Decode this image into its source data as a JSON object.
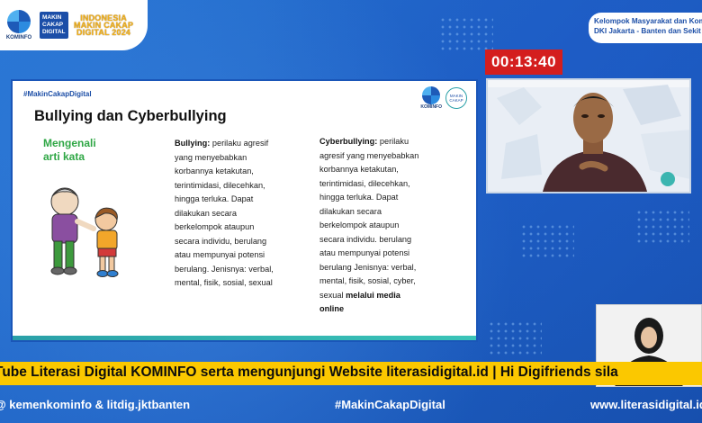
{
  "header": {
    "kominfo_label": "KOMINFO",
    "mcd_lines": [
      "MAKIN",
      "CAKAP",
      "DIGITAL"
    ],
    "imcd_lines": [
      "INDONESIA",
      "MAKIN CAKAP",
      "DIGITAL 2024"
    ],
    "org_line1": "Kelompok Masyarakat dan Kom",
    "org_line2": "DKI Jakarta - Banten dan Sekit"
  },
  "timer": "00:13:40",
  "slide": {
    "hashtag": "#MakinCakapDigital",
    "logo_label": "KOMINFO",
    "mcd_badge": "MAKIN CAKAP",
    "title": "Bullying dan Cyberbullying",
    "subtitle_line1": "Mengenali",
    "subtitle_line2": "arti kata",
    "col1_term": "Bullying:",
    "col1_text": " perilaku agresif yang menyebabkan korbannya ketakutan, terintimidasi, dilecehkan, hingga terluka. Dapat dilakukan secara berkelompok ataupun secara individu, berulang atau mempunyai potensi berulang. Jenisnya: verbal, mental, fisik, sosial, sexual",
    "col2_term": "Cyberbullying:",
    "col2_text": " perilaku agresif yang menyebabkan korbannya ketakutan, terintimidasi, dilecehkan, hingga terluka. Dapat dilakukan secara berkelompok ataupun secara individu. berulang atau mempunyai potensi berulang Jenisnya: verbal, mental, fisik, sosial, cyber, sexual ",
    "col2_tail": "melalui media online"
  },
  "ticker": "Tube Literasi Digital KOMINFO serta mengunjungi Website literasidigital.id  |  Hi Digifriends sila",
  "footer": {
    "social": "@ kemenkominfo & litdig.jktbanten",
    "hashtag": "#MakinCakapDigital",
    "website": "www.literasidigital.id"
  },
  "colors": {
    "background": "#1f66c9",
    "ticker": "#fbc800",
    "timer": "#d41e1e",
    "subtitle_green": "#2fa745"
  }
}
